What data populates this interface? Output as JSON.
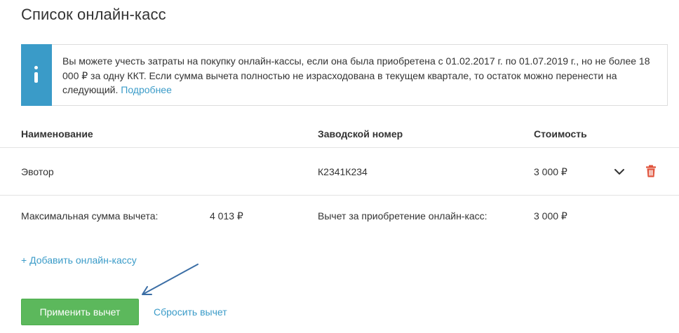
{
  "page": {
    "title": "Список онлайн-касс"
  },
  "info": {
    "text": "Вы можете учесть затраты на покупку онлайн-кассы, если она была приобретена с 01.02.2017 г. по 01.07.2019 г., но не более 18 000 ₽ за одну ККТ. Если сумма вычета полностью не израсходована в текущем квартале, то остаток можно перенести на следующий.",
    "link": "Подробнее",
    "icon": "info-icon",
    "accent_color": "#3a9bc8"
  },
  "table": {
    "columns": {
      "name": "Наименование",
      "serial": "Заводской номер",
      "cost": "Стоимость"
    },
    "rows": [
      {
        "name": "Эвотор",
        "serial": "К2341К234",
        "cost": "3 000 ₽",
        "expand_icon": "chevron-down-icon",
        "delete_icon": "trash-icon",
        "delete_color": "#e0533c"
      }
    ]
  },
  "summary": {
    "max_label": "Максимальная сумма вычета:",
    "max_value": "4 013 ₽",
    "deduction_label": "Вычет за приобретение онлайн-касс:",
    "deduction_value": "3 000 ₽"
  },
  "actions": {
    "add_label": "+ Добавить онлайн-кассу",
    "apply_label": "Применить вычет",
    "reset_label": "Сбросить вычет",
    "apply_color": "#5cb85c",
    "link_color": "#3a9bc8"
  }
}
